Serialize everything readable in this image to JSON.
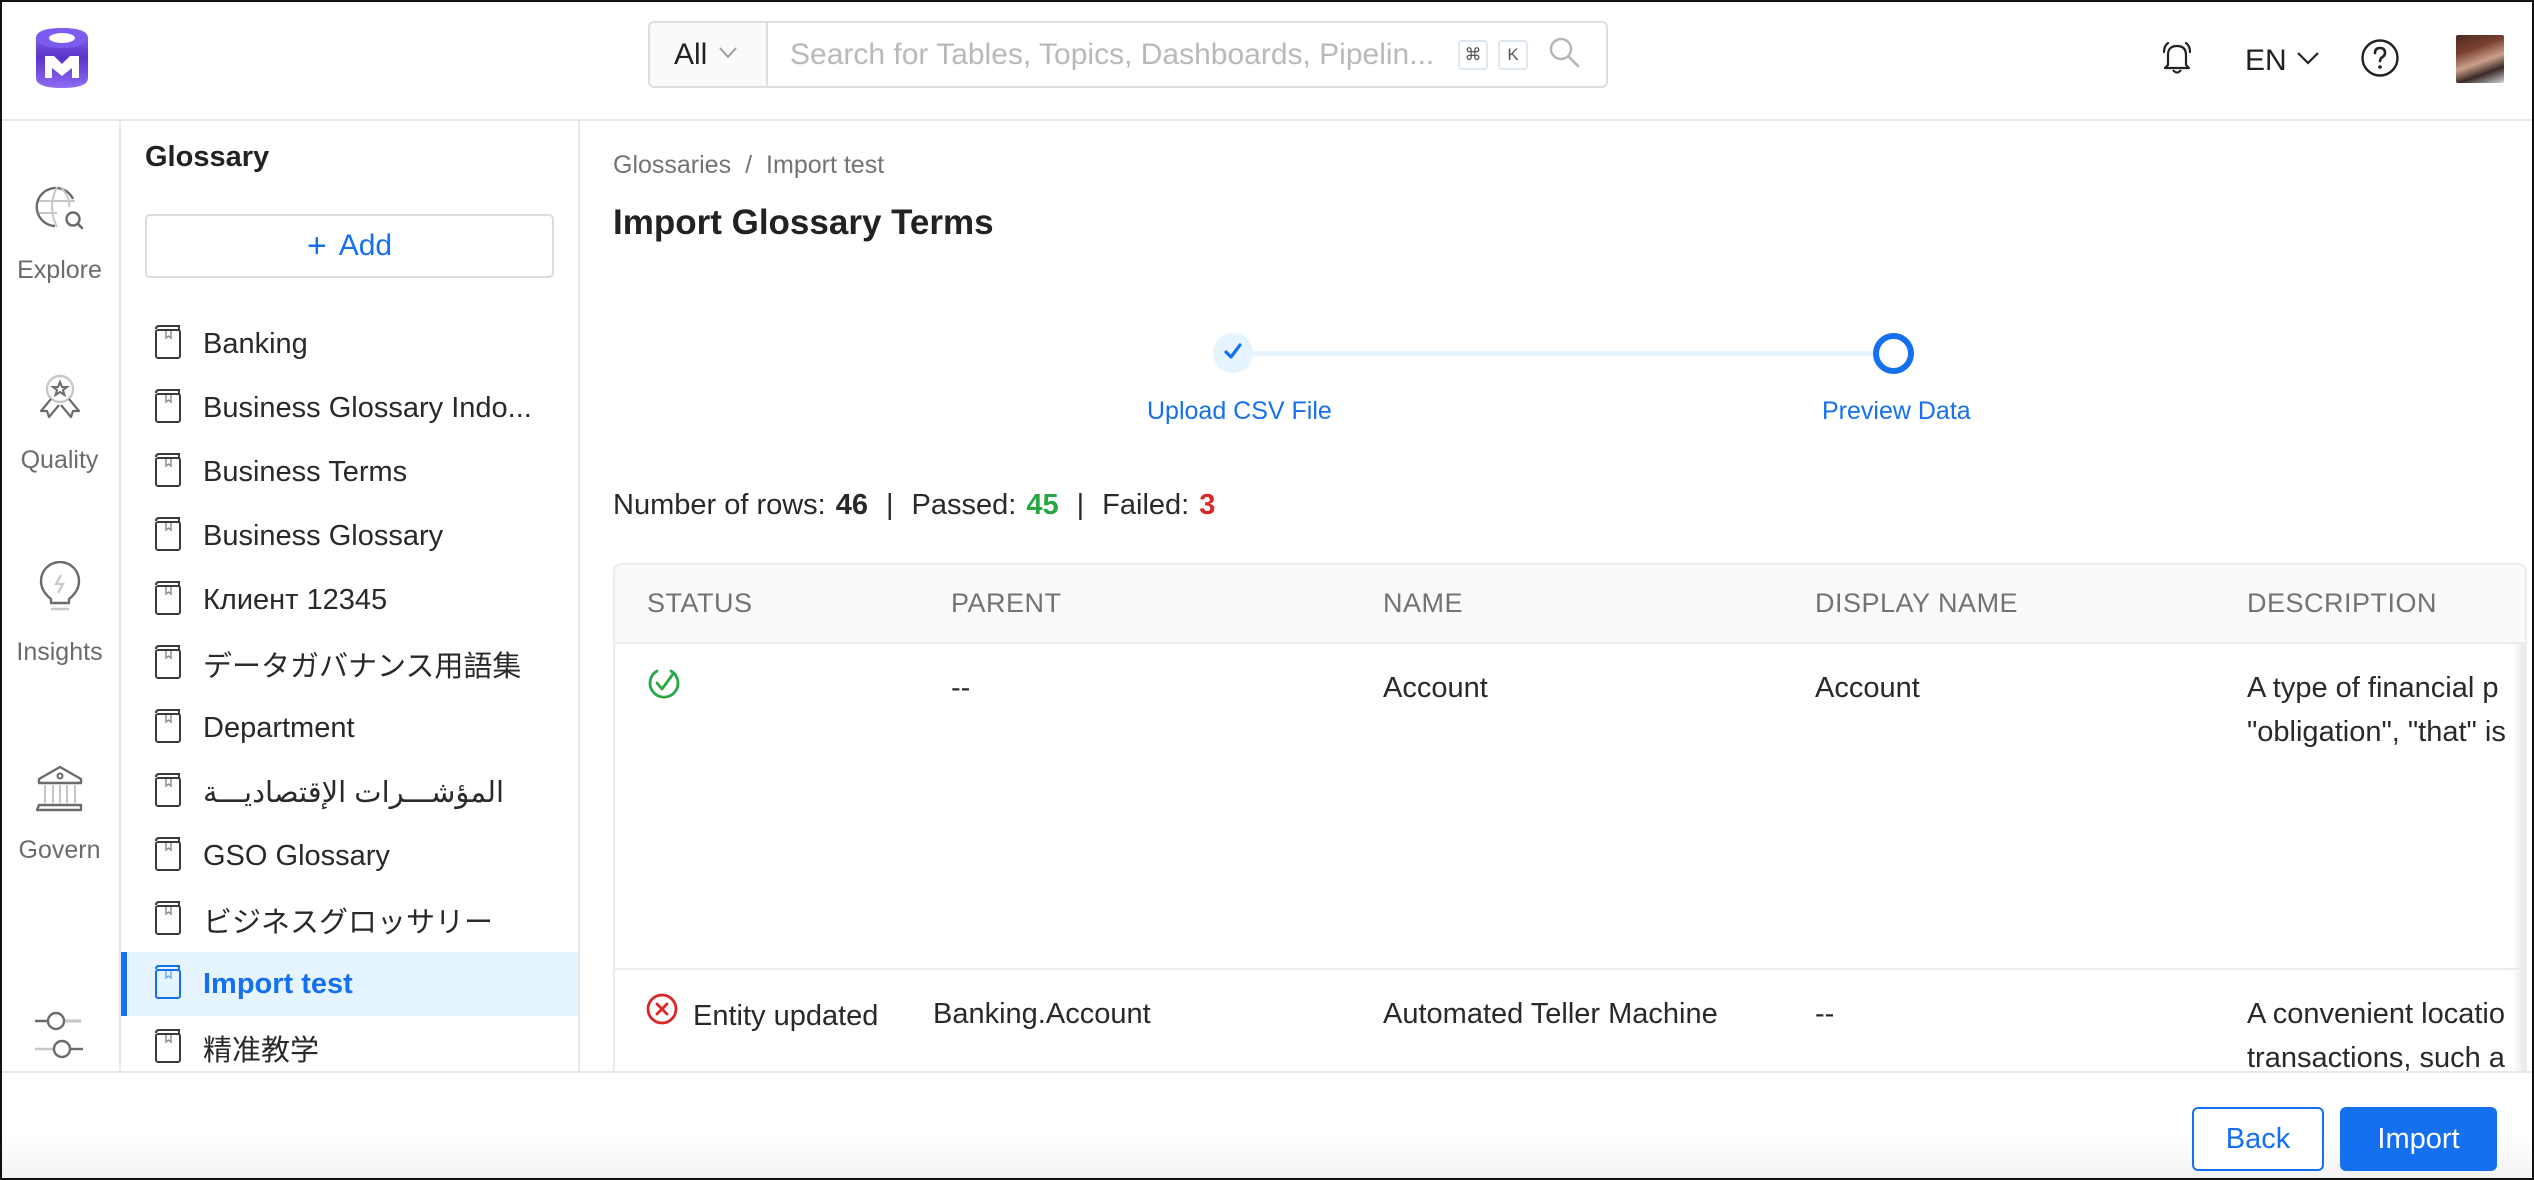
{
  "header": {
    "search": {
      "scope": "All",
      "placeholder": "Search for Tables, Topics, Dashboards, Pipelin...",
      "value": "",
      "shortcut_keys": [
        "⌘",
        "K"
      ]
    },
    "language": "EN",
    "icons": [
      "bell-icon",
      "chevron-down-icon",
      "help-icon",
      "avatar"
    ]
  },
  "leftnav": {
    "items": [
      {
        "label": "Explore",
        "icon": "globe-search-icon"
      },
      {
        "label": "Quality",
        "icon": "award-icon"
      },
      {
        "label": "Insights",
        "icon": "lightbulb-icon"
      },
      {
        "label": "Govern",
        "icon": "bank-icon"
      }
    ],
    "settings_icon": "settings-sliders-icon"
  },
  "glossary_panel": {
    "title": "Glossary",
    "add_label": "Add",
    "items": [
      {
        "label": "Banking",
        "selected": false
      },
      {
        "label": "Business Glossary Indo...",
        "selected": false
      },
      {
        "label": "Business Terms",
        "selected": false
      },
      {
        "label": "Business Glossary",
        "selected": false
      },
      {
        "label": "Клиент 12345",
        "selected": false
      },
      {
        "label": "データガバナンス用語集",
        "selected": false
      },
      {
        "label": "Department",
        "selected": false
      },
      {
        "label": "المؤشـــرات الإقتصاديـــة",
        "selected": false
      },
      {
        "label": "GSO Glossary",
        "selected": false
      },
      {
        "label": "ビジネスグロッサリー",
        "selected": false
      },
      {
        "label": "Import test",
        "selected": true
      },
      {
        "label": "精准教学",
        "selected": false
      }
    ]
  },
  "main": {
    "breadcrumb": [
      {
        "label": "Glossaries"
      },
      {
        "label": "Import test"
      }
    ],
    "breadcrumb_separator": "/",
    "title": "Import Glossary Terms",
    "stepper": {
      "steps": [
        {
          "label": "Upload CSV File",
          "state": "completed"
        },
        {
          "label": "Preview Data",
          "state": "active"
        }
      ]
    },
    "stats": {
      "rows_label": "Number of rows:",
      "rows_value": "46",
      "passed_label": "Passed:",
      "passed_value": "45",
      "failed_label": "Failed:",
      "failed_value": "3",
      "separator": "|"
    },
    "table": {
      "columns": [
        "STATUS",
        "PARENT",
        "NAME",
        "DISPLAY NAME",
        "DESCRIPTION"
      ],
      "rows": [
        {
          "status": "success",
          "status_text": "",
          "parent": "--",
          "name": "Account",
          "display_name": "Account",
          "description_lines": [
            "A type of financial p",
            "\"obligation\", \"that\" is"
          ]
        },
        {
          "status": "failure",
          "status_text": "Entity updated",
          "parent": "Banking.Account",
          "name": "Automated Teller Machine",
          "display_name": "--",
          "description_lines": [
            "A convenient locatio",
            "transactions, such a"
          ]
        }
      ]
    }
  },
  "footer": {
    "back_label": "Back",
    "import_label": "Import"
  },
  "colors": {
    "primary": "#1570ef",
    "success": "#28a745",
    "danger": "#dc2626",
    "logo": "#7147e8"
  }
}
